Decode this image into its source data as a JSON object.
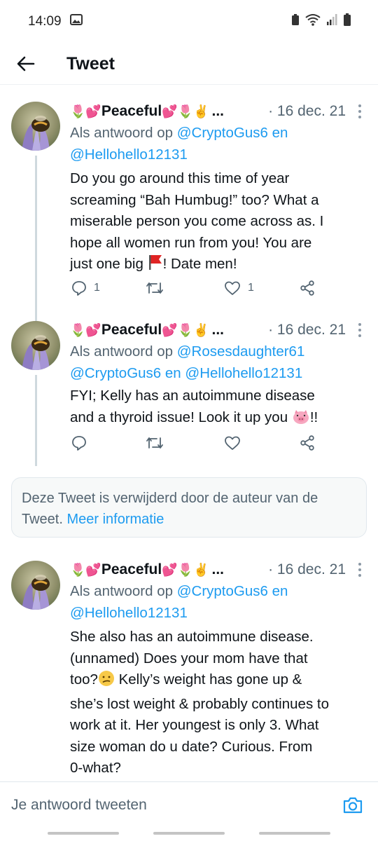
{
  "status_bar": {
    "time": "14:09"
  },
  "header": {
    "title": "Tweet"
  },
  "tweets": [
    {
      "name": "Peaceful",
      "ellipsis": "...",
      "date": "· 16 dec. 21",
      "reply_prefix": "Als antwoord op ",
      "mentions": [
        "@CryptoGus6",
        "@Hellohello12131"
      ],
      "connector": " en",
      "text_lines": [
        "Do you go around this time of year",
        "screaming “Bah Humbug!” too? What a",
        "miserable person you come across as. I",
        "hope all women run from you! You are"
      ],
      "text_last_a": "just one big ",
      "text_last_b": "! Date men!",
      "reply_count": "1",
      "like_count": "1"
    },
    {
      "name": "Peaceful",
      "ellipsis": "...",
      "date": "· 16 dec. 21",
      "reply_prefix": "Als antwoord op ",
      "mentions": [
        "@Rosesdaughter61",
        "@CryptoGus6",
        "@Hellohello12131"
      ],
      "connector": " en ",
      "text_line1": "FYI; Kelly has an autoimmune disease",
      "text_line2_a": "and a thyroid issue! Look it up you ",
      "text_line2_b": "!!"
    },
    {
      "name": "Peaceful",
      "ellipsis": "...",
      "date": "· 16 dec. 21",
      "reply_prefix": "Als antwoord op ",
      "mentions": [
        "@CryptoGus6",
        "@Hellohello12131"
      ],
      "connector": " en",
      "text_line1": "She also has an autoimmune disease.",
      "text_line2": "(unnamed) Does your mom have that",
      "text_line3": "too?",
      "text_line3_b": " Kelly’s weight has gone up &",
      "text_lines_rest": [
        "she’s lost weight & probably continues to",
        "work at it. Her youngest is only 3. What",
        "size woman do u date? Curious. From",
        "0-what?"
      ]
    }
  ],
  "deleted_notice": {
    "text": "Deze Tweet is verwijderd door de auteur van de Tweet.",
    "link": "Meer informatie"
  },
  "composer": {
    "placeholder": "Je antwoord tweeten"
  },
  "colors": {
    "accent": "#1d9bf0",
    "muted": "#536471",
    "text": "#0f1419"
  },
  "icons": [
    "back-arrow-icon",
    "reply-icon",
    "retweet-icon",
    "like-icon",
    "share-icon",
    "more-icon",
    "camera-icon"
  ]
}
